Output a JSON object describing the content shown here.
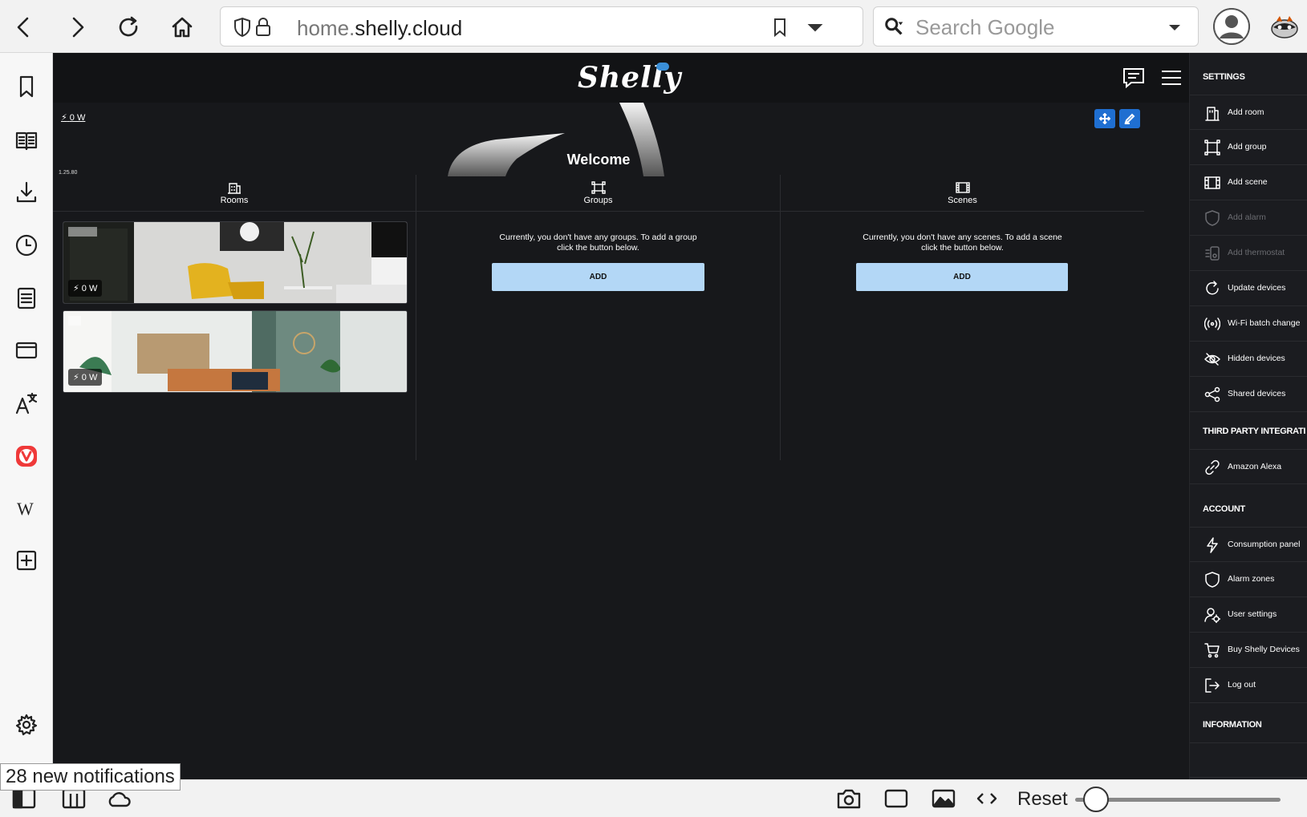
{
  "browser": {
    "url_host_dim": "home.",
    "url_host_main": "shelly.cloud",
    "search_placeholder": "Search Google",
    "notification": "28 new notifications",
    "zoom_reset_label": "Reset",
    "zoom_level": 0.1
  },
  "app": {
    "logo": "Shelly",
    "total_power": "0 W",
    "version": "1.25.80",
    "welcome": "Welcome",
    "columns": {
      "rooms": "Rooms",
      "groups": "Groups",
      "scenes": "Scenes"
    },
    "groups_empty": "Currently, you don't have any groups. To add a group click the button below.",
    "scenes_empty": "Currently, you don't have any scenes. To add a scene click the button below.",
    "add_label": "ADD",
    "rooms": [
      {
        "power": "0 W"
      },
      {
        "power": "0 W"
      }
    ],
    "accent_color": "#1f6fd1",
    "add_button_color": "#b3d7f6"
  },
  "settings": {
    "sections": [
      {
        "title": "SETTINGS",
        "items": [
          {
            "label": "Add room",
            "icon": "building-icon",
            "enabled": true
          },
          {
            "label": "Add group",
            "icon": "group-icon",
            "enabled": true
          },
          {
            "label": "Add scene",
            "icon": "film-icon",
            "enabled": true
          },
          {
            "label": "Add alarm",
            "icon": "shield-icon",
            "enabled": false
          },
          {
            "label": "Add thermostat",
            "icon": "thermostat-icon",
            "enabled": false
          },
          {
            "label": "Update devices",
            "icon": "refresh-icon",
            "enabled": true
          },
          {
            "label": "Wi-Fi batch change",
            "icon": "wifi-broadcast-icon",
            "enabled": true
          },
          {
            "label": "Hidden devices",
            "icon": "eye-off-icon",
            "enabled": true
          },
          {
            "label": "Shared devices",
            "icon": "share-icon",
            "enabled": true
          }
        ]
      },
      {
        "title": "THIRD PARTY INTEGRATI",
        "items": [
          {
            "label": "Amazon Alexa",
            "icon": "link-icon",
            "enabled": true
          }
        ]
      },
      {
        "title": "ACCOUNT",
        "items": [
          {
            "label": "Consumption panel",
            "icon": "bolt-icon",
            "enabled": true
          },
          {
            "label": "Alarm zones",
            "icon": "shield-icon",
            "enabled": true
          },
          {
            "label": "User settings",
            "icon": "user-gear-icon",
            "enabled": true
          },
          {
            "label": "Buy Shelly Devices",
            "icon": "cart-icon",
            "enabled": true
          },
          {
            "label": "Log out",
            "icon": "logout-icon",
            "enabled": true
          }
        ]
      },
      {
        "title": "INFORMATION",
        "items": []
      }
    ]
  }
}
